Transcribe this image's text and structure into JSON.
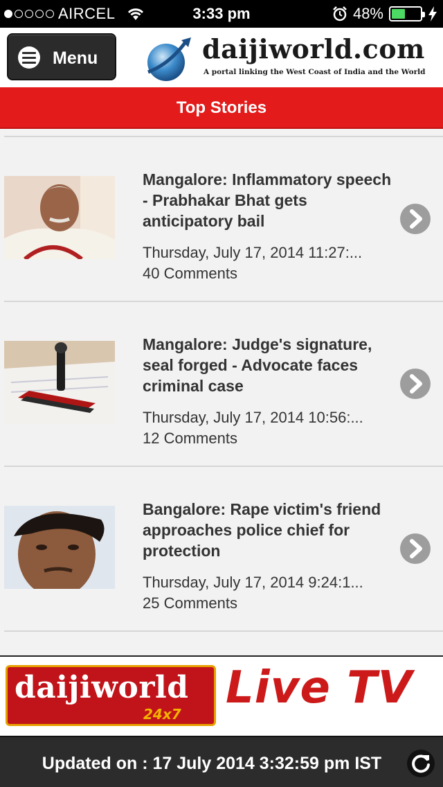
{
  "status_bar": {
    "carrier": "AIRCEL",
    "time": "3:33 pm",
    "battery_percent": "48%",
    "battery_level": 0.48,
    "signal_bars_filled": 1,
    "signal_bars_total": 5
  },
  "header": {
    "menu_label": "Menu",
    "logo_text": "daijiworld.com",
    "logo_tagline": "A portal linking the West Coast of India and the World"
  },
  "section": {
    "title": "Top Stories"
  },
  "news": [
    {
      "headline": "Mangalore: Inflammatory speech - Prabhakar Bhat gets anticipatory bail",
      "date": "Thursday, July 17, 2014 11:27:...",
      "comments": "40 Comments",
      "thumb_icon": "person-portrait-thumbnail"
    },
    {
      "headline": "Mangalore: Judge's signature, seal forged - Advocate faces criminal case",
      "date": "Thursday, July 17, 2014 10:56:...",
      "comments": "12 Comments",
      "thumb_icon": "rubber-stamp-thumbnail"
    },
    {
      "headline": "Bangalore: Rape victim's friend approaches police chief for protection",
      "date": "Thursday, July 17, 2014 9:24:1...",
      "comments": "25 Comments",
      "thumb_icon": "face-portrait-thumbnail"
    }
  ],
  "banner": {
    "logo_text": "daijiworld",
    "logo_sub": "24x7",
    "live_tv": "Live TV"
  },
  "footer": {
    "updated_text": "Updated on : 17 July 2014 3:32:59 pm IST"
  },
  "colors": {
    "accent_red": "#e31b1b",
    "dark_bar": "#2c2c2c",
    "battery_green": "#4cd964"
  }
}
